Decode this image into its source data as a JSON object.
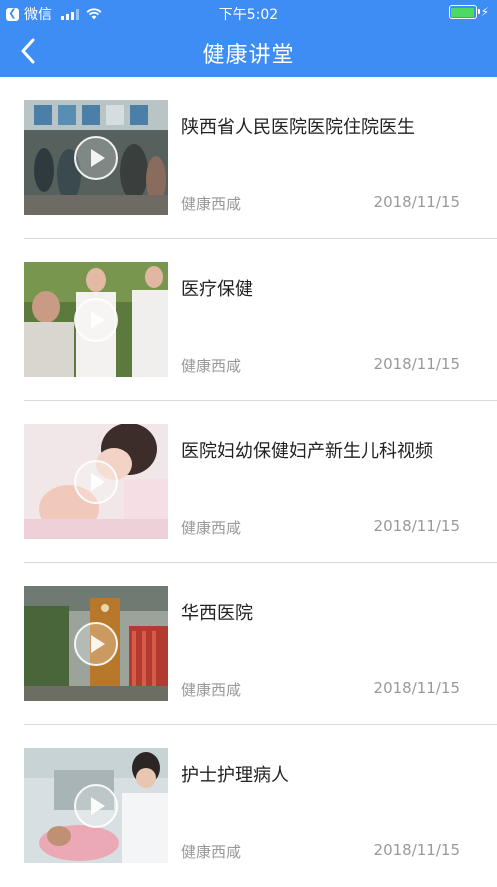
{
  "status_bar": {
    "carrier": "微信",
    "time": "下午5:02"
  },
  "nav": {
    "title": "健康讲堂"
  },
  "items": [
    {
      "title": "陕西省人民医院医院住院医生",
      "source": "健康西咸",
      "date": "2018/11/15"
    },
    {
      "title": "医疗保健",
      "source": "健康西咸",
      "date": "2018/11/15"
    },
    {
      "title": "医院妇幼保健妇产新生儿科视频",
      "source": "健康西咸",
      "date": "2018/11/15"
    },
    {
      "title": "华西医院",
      "source": "健康西咸",
      "date": "2018/11/15"
    },
    {
      "title": "护士护理病人",
      "source": "健康西咸",
      "date": "2018/11/15"
    }
  ],
  "colors": {
    "accent": "#3d8df5",
    "divider": "#d9d9d9",
    "meta_text": "#999999"
  },
  "icons": [
    "back-app-icon",
    "signal-icon",
    "wifi-icon",
    "battery-icon",
    "charging-icon",
    "back-chevron-icon",
    "play-icon"
  ]
}
